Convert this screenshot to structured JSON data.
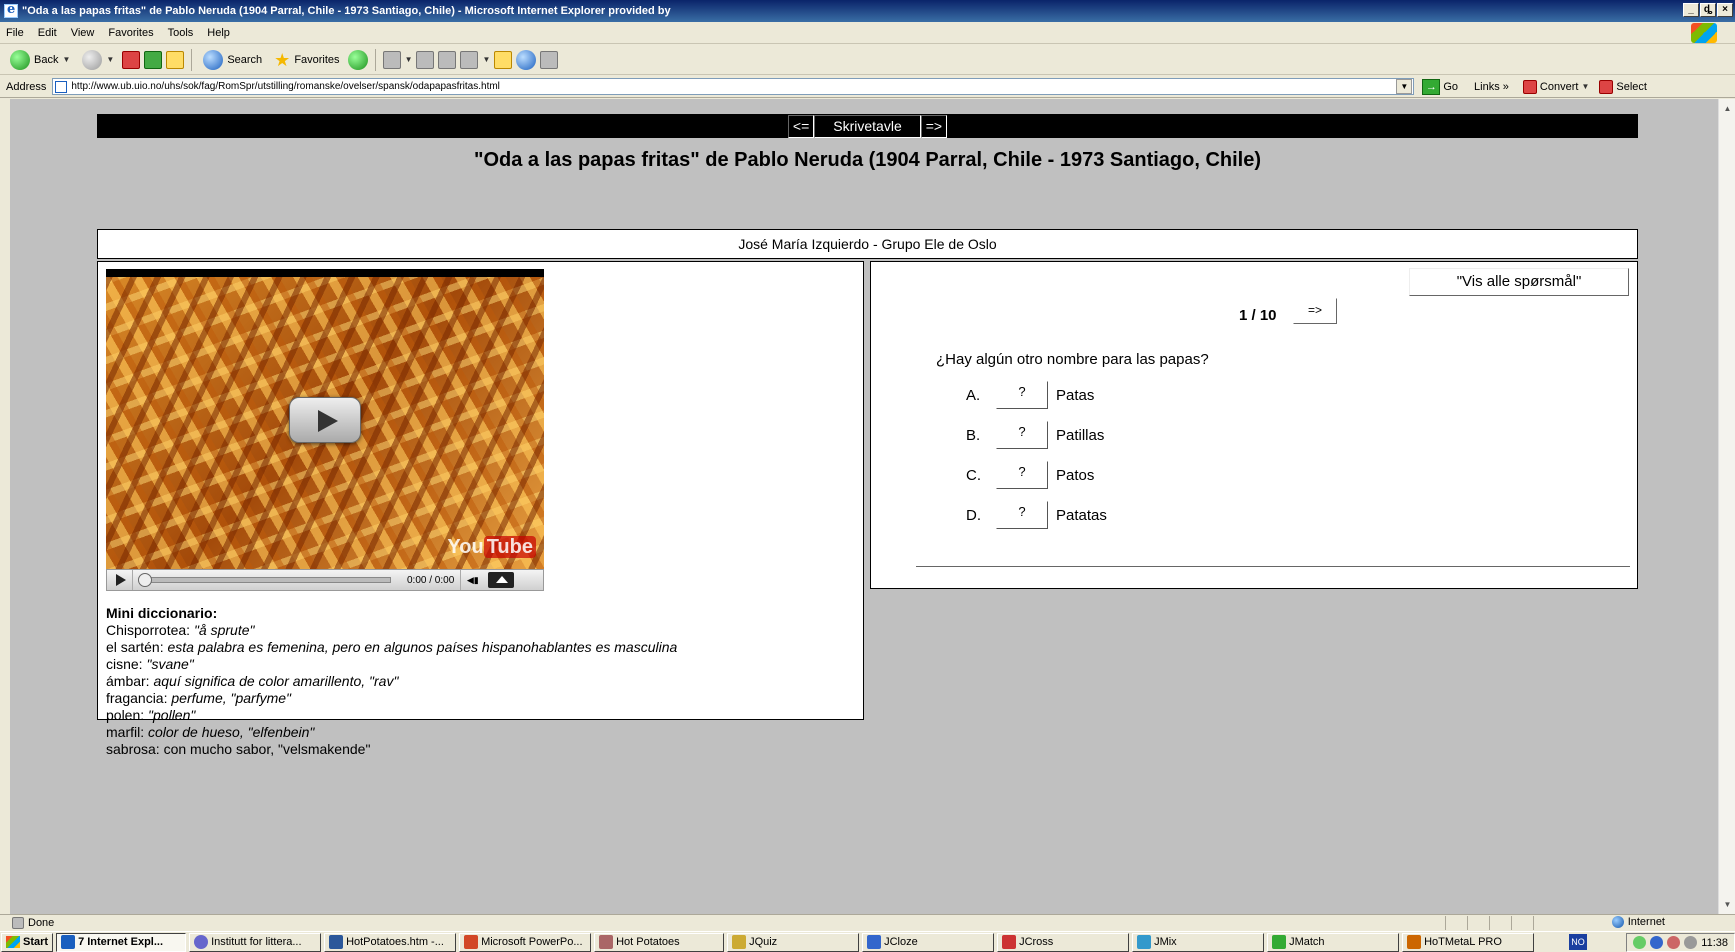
{
  "window": {
    "title": "\"Oda a las papas fritas\" de Pablo Neruda (1904 Parral, Chile - 1973 Santiago, Chile) - Microsoft Internet Explorer provided by",
    "minimize": "_",
    "maximize": "ȡ",
    "close": "×"
  },
  "menu": [
    "File",
    "Edit",
    "View",
    "Favorites",
    "Tools",
    "Help"
  ],
  "toolbar": {
    "back": "Back",
    "search": "Search",
    "favorites": "Favorites"
  },
  "address": {
    "label": "Address",
    "url": "http://www.ub.uio.no/uhs/sok/fag/RomSpr/utstilling/romanske/ovelser/spansk/odapapasfritas.html",
    "go": "Go",
    "links": "Links",
    "convert": "Convert",
    "select": "Select"
  },
  "page": {
    "nav_prev": "<=",
    "nav_center": "Skrivetavle",
    "nav_next": "=>",
    "title": "\"Oda a las papas fritas\" de Pablo Neruda (1904 Parral, Chile - 1973 Santiago, Chile)",
    "author": "José María Izquierdo - Grupo Ele de Oslo",
    "video": {
      "time": "0:00 / 0:00",
      "logo_you": "You",
      "logo_tube": "Tube"
    },
    "dictionary": {
      "heading": "Mini diccionario:",
      "entries": [
        {
          "term": "Chisporrotea: ",
          "def": "\"å sprute\""
        },
        {
          "term": "el sartén: ",
          "def": "esta palabra es femenina, pero en algunos países hispanohablantes es masculina"
        },
        {
          "term": "cisne: ",
          "def": "\"svane\""
        },
        {
          "term": "ámbar: ",
          "def": "aquí significa de color amarillento, \"rav\""
        },
        {
          "term": "fragancia: ",
          "def": "perfume, \"parfyme\""
        },
        {
          "term": "polen: ",
          "def": "\"pollen\""
        },
        {
          "term": "marfil: ",
          "def": "color de hueso, \"elfenbein\""
        },
        {
          "term": "sabrosa: ",
          "def": "con mucho sabor, \"velsmakende\""
        }
      ]
    },
    "quiz": {
      "show_all": "\"Vis alle spørsmål\"",
      "counter": "1 / 10",
      "next": "=>",
      "question": "¿Hay algún otro nombre para las papas?",
      "options": [
        {
          "letter": "A.",
          "button": "?",
          "text": "Patas"
        },
        {
          "letter": "B.",
          "button": "?",
          "text": "Patillas"
        },
        {
          "letter": "C.",
          "button": "?",
          "text": "Patos"
        },
        {
          "letter": "D.",
          "button": "?",
          "text": "Patatas"
        }
      ]
    }
  },
  "status": {
    "text": "Done",
    "zone": "Internet"
  },
  "taskbar": {
    "start": "Start",
    "tasks": [
      "7 Internet Expl...",
      "Institutt for littera...",
      "HotPotatoes.htm -...",
      "Microsoft PowerPo...",
      "Hot Potatoes",
      "JQuiz",
      "JCloze",
      "JCross",
      "JMix",
      "JMatch",
      "HoTMetaL PRO"
    ],
    "lang": "NO",
    "clock": "11:38"
  }
}
